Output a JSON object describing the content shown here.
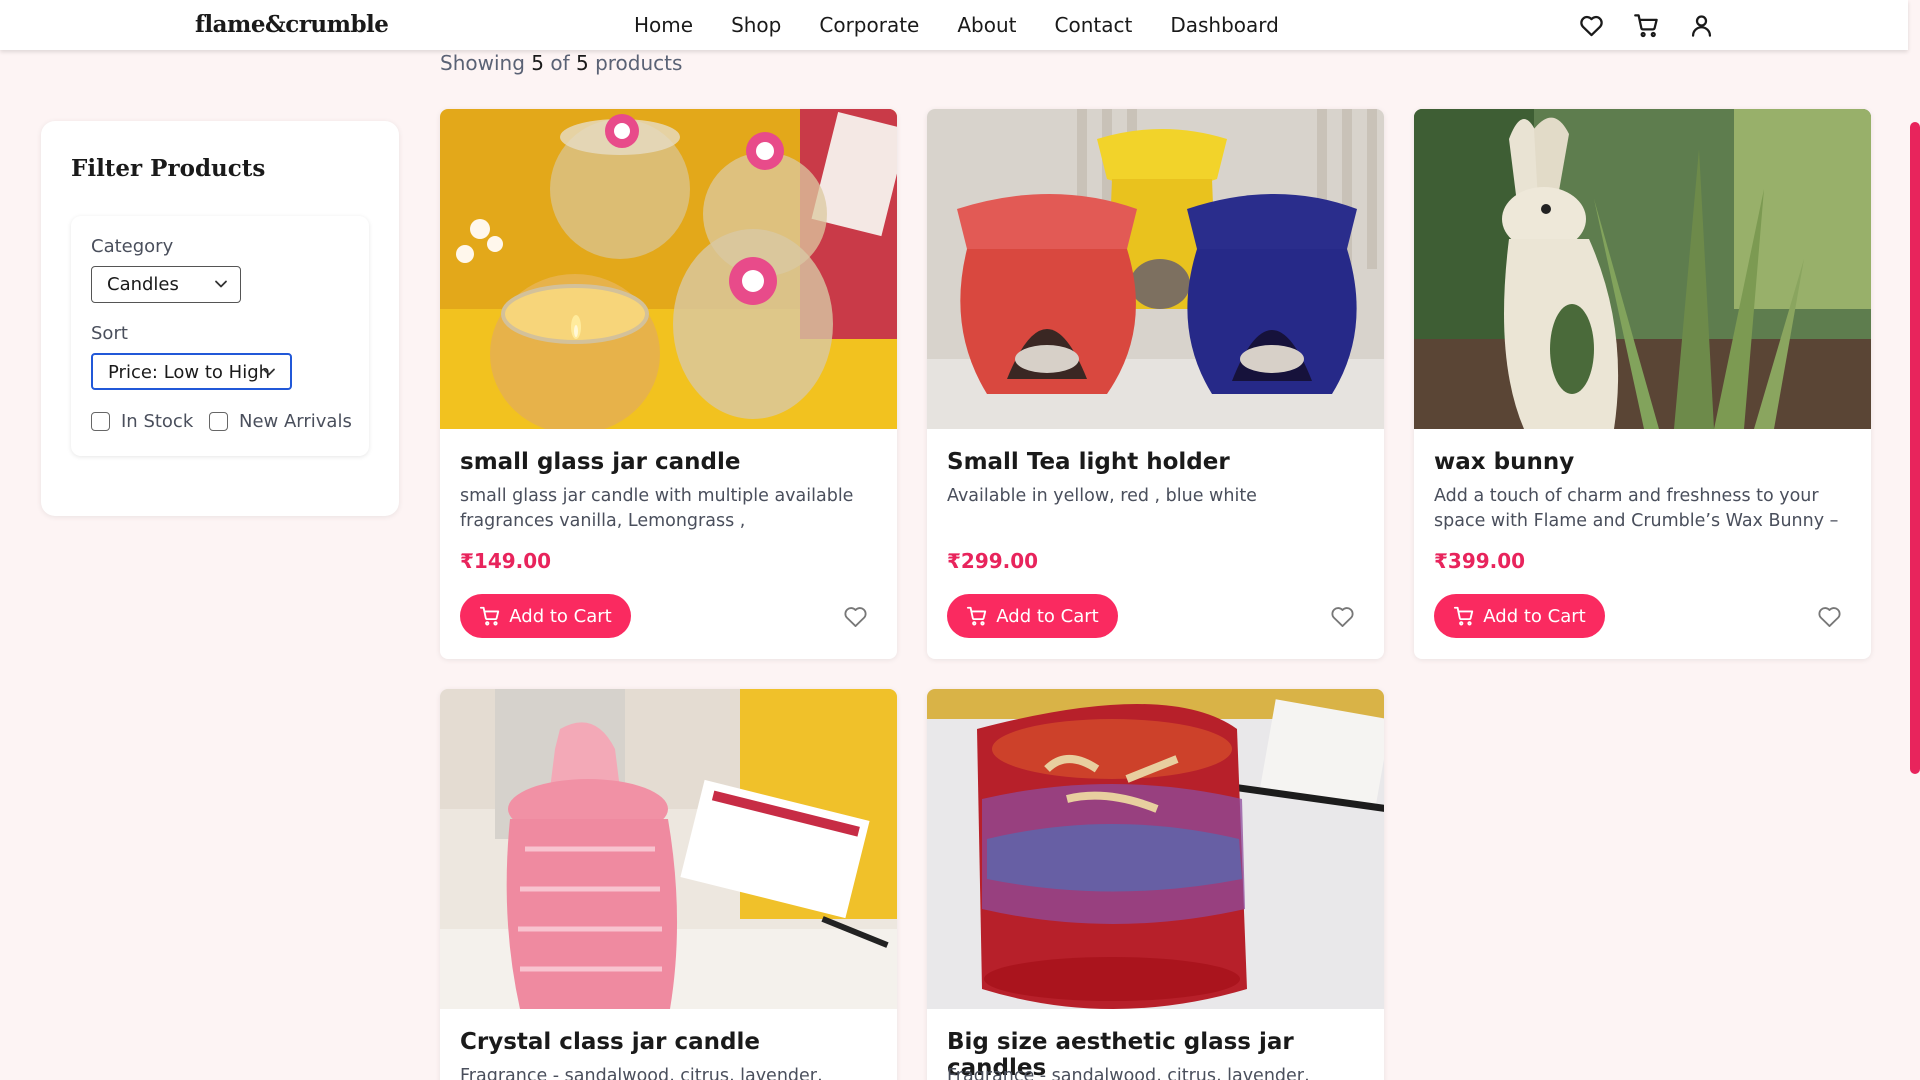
{
  "header": {
    "logo": "flame&crumble",
    "nav": [
      "Home",
      "Shop",
      "Corporate",
      "About",
      "Contact",
      "Dashboard"
    ],
    "icons": [
      "heart-icon",
      "cart-icon",
      "user-icon"
    ]
  },
  "listing": {
    "prefix": "Showing ",
    "shown": "5",
    "of": " of ",
    "total": "5",
    "suffix": " products"
  },
  "filters": {
    "title": "Filter Products",
    "category_label": "Category",
    "category_value": "Candles",
    "sort_label": "Sort",
    "sort_value": "Price: Low to High",
    "checkbox_in_stock": "In Stock",
    "checkbox_new_arrivals": "New Arrivals"
  },
  "products": [
    {
      "name": "small glass jar candle",
      "desc": "small glass jar candle with multiple available fragrances vanilla, Lemongrass ,",
      "price": "₹149.00",
      "button": "Add to Cart"
    },
    {
      "name": "Small Tea light holder",
      "desc": "Available in yellow, red , blue white",
      "price": "₹299.00",
      "button": "Add to Cart"
    },
    {
      "name": "wax bunny",
      "desc": "Add a touch of charm and freshness to your space with Flame and Crumble’s Wax Bunny –",
      "price": "₹399.00",
      "button": "Add to Cart"
    },
    {
      "name": "Crystal class jar candle",
      "desc": "Fragrance - sandalwood, citrus, lavender, ylang",
      "price": "",
      "button": ""
    },
    {
      "name": "Big size aesthetic glass jar candles",
      "desc": "Fragrance - sandalwood, citrus, lavender, ylang",
      "price": "",
      "button": ""
    }
  ],
  "colors": {
    "accent": "#fa2a60",
    "price": "#e8245c",
    "background": "#fdf4f4",
    "focus": "#2158d8"
  }
}
